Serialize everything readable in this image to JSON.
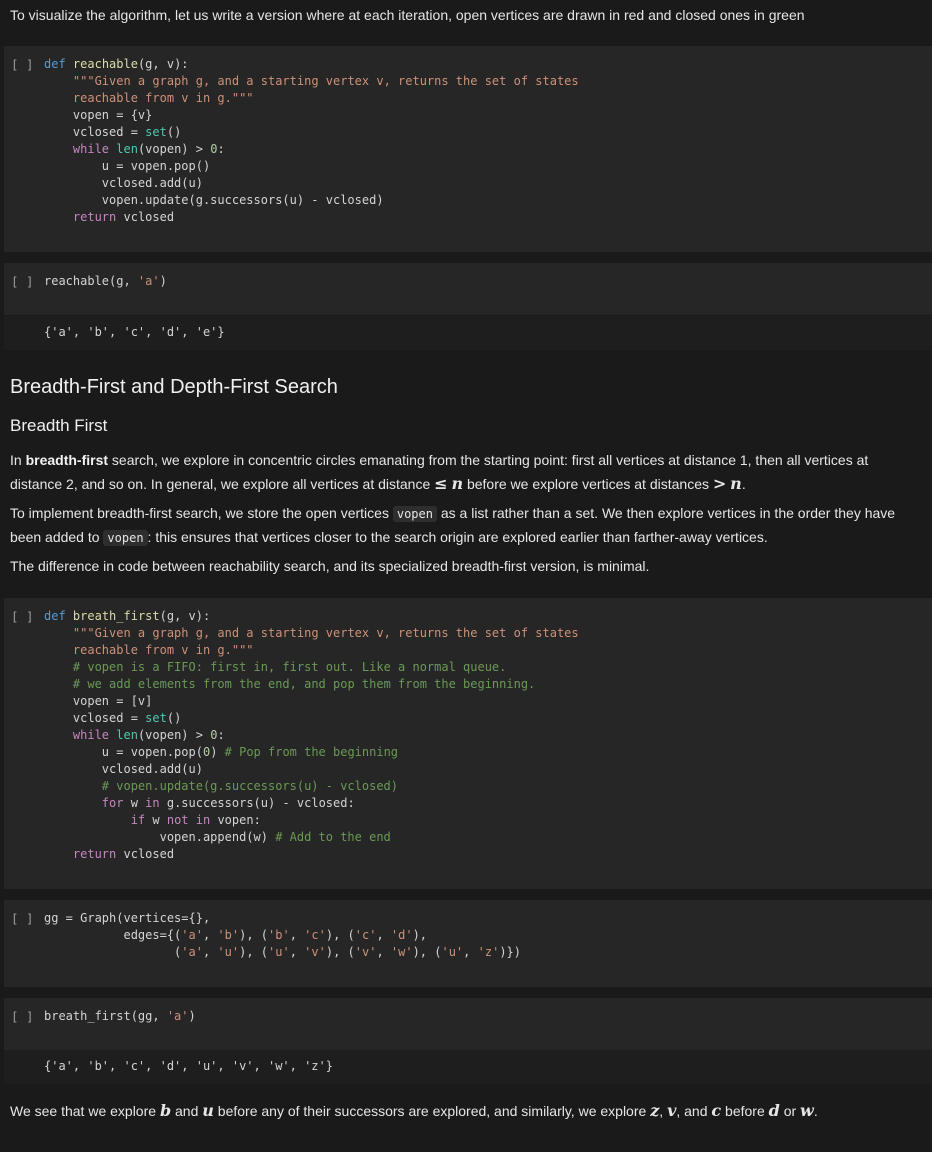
{
  "intro_text": "To visualize the algorithm, let us write a version where at each iteration, open vertices are drawn in red and closed ones in green",
  "cell_bracket": "[ ]",
  "cell1": {
    "code": [
      "def reachable(g, v):",
      "    \"\"\"Given a graph g, and a starting vertex v, returns the set of states",
      "    reachable from v in g.\"\"\"",
      "    vopen = {v}",
      "    vclosed = set()",
      "    while len(vopen) > 0:",
      "        u = vopen.pop()",
      "        vclosed.add(u)",
      "        vopen.update(g.successors(u) - vclosed)",
      "    return vclosed"
    ]
  },
  "cell2": {
    "code": "reachable(g, 'a')",
    "output": "{'a', 'b', 'c', 'd', 'e'}"
  },
  "heading1": "Breadth-First and Depth-First Search",
  "heading2": "Breadth First",
  "para1": {
    "p1": "In ",
    "bold": "breadth-first",
    "p2": " search, we explore in concentric circles emanating from the starting point: first all vertices at distance 1, then all vertices at distance 2, and so on. In general, we explore all vertices at distance ",
    "le": "≤",
    "n1": "n",
    "p3": " before we explore vertices at distances ",
    "gt": ">",
    "n2": "n",
    "p4": "."
  },
  "para2": {
    "p1": "To implement breadth-first search, we store the open vertices ",
    "code1": "vopen",
    "p2": " as a list rather than a set. We then explore vertices in the order they have been added to ",
    "code2": "vopen",
    "p3": ": this ensures that vertices closer to the search origin are explored earlier than farther-away vertices."
  },
  "para3": "The difference in code between reachability search, and its specialized breadth-first version, is minimal.",
  "cell3": {
    "code": [
      "def breath_first(g, v):",
      "    \"\"\"Given a graph g, and a starting vertex v, returns the set of states",
      "    reachable from v in g.\"\"\"",
      "    # vopen is a FIFO: first in, first out. Like a normal queue.",
      "    # we add elements from the end, and pop them from the beginning.",
      "    vopen = [v]",
      "    vclosed = set()",
      "    while len(vopen) > 0:",
      "        u = vopen.pop(0) # Pop from the beginning",
      "        vclosed.add(u)",
      "        # vopen.update(g.successors(u) - vclosed)",
      "        for w in g.successors(u) - vclosed:",
      "            if w not in vopen:",
      "                vopen.append(w) # Add to the end",
      "    return vclosed"
    ]
  },
  "cell4": {
    "code": [
      "gg = Graph(vertices={},",
      "           edges={('a', 'b'), ('b', 'c'), ('c', 'd'),",
      "                  ('a', 'u'), ('u', 'v'), ('v', 'w'), ('u', 'z')})"
    ]
  },
  "cell5": {
    "code": "breath_first(gg, 'a')",
    "output": "{'a', 'b', 'c', 'd', 'u', 'v', 'w', 'z'}"
  },
  "final": {
    "p1": "We see that we explore ",
    "b": "b",
    "p2": " and ",
    "u": "u",
    "p3": " before any of their successors are explored, and similarly, we explore ",
    "z": "z",
    "c1": ", ",
    "v": "v",
    "c2": ", and ",
    "c": "c",
    "p4": " before ",
    "d": "d",
    "p5": " or ",
    "w": "w",
    "p6": "."
  }
}
